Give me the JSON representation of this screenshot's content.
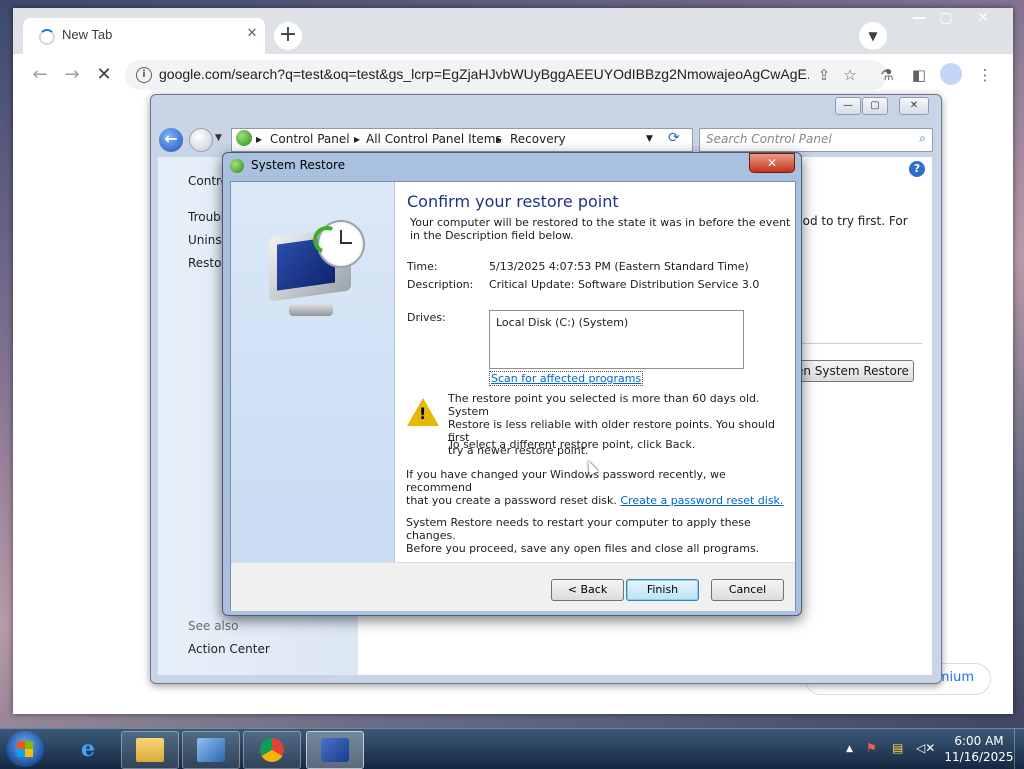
{
  "browser": {
    "tab_title": "New Tab",
    "url": "google.com/search?q=test&oq=test&gs_lcrp=EgZjaHJvbWUyBggAEEUYOdIBBzg2NmowajeoAgCwAgE...",
    "premium_label": "Premium"
  },
  "control_panel": {
    "breadcrumb": [
      "Control Panel",
      "All Control Panel Items",
      "Recovery"
    ],
    "search_placeholder": "Search Control Panel",
    "left_links": [
      "Contro",
      "Troubl",
      "Uninst",
      "Restor"
    ],
    "right_text": "hod to try first. For",
    "open_button": "en System Restore",
    "see_also": "See also",
    "action_center": "Action Center"
  },
  "system_restore": {
    "title": "System Restore",
    "heading": "Confirm your restore point",
    "intro_line1": "Your computer will be restored to the state it was in before the event",
    "intro_line2": "in the Description field below.",
    "time_label": "Time:",
    "time_value": "5/13/2025 4:07:53 PM (Eastern Standard Time)",
    "desc_label": "Description:",
    "desc_value": "Critical Update: Software Distribution Service 3.0",
    "drives_label": "Drives:",
    "drive_item": "Local Disk (C:) (System)",
    "scan_link": "Scan for affected programs",
    "warn_line1": "The restore point you selected is more than 60 days old. System",
    "warn_line2": "Restore is less reliable with older restore points. You should first",
    "warn_line3": "try a newer restore point.",
    "select_back": "To select a different restore point, click Back.",
    "pwd_line1": "If you have changed your Windows password recently, we recommend",
    "pwd_line2": "that you create a password reset disk.",
    "pwd_link": "Create a password reset disk.",
    "restart_line1": "System Restore needs to restart your computer to apply these changes.",
    "restart_line2": "Before you proceed, save any open files and close all programs.",
    "back_button": "< Back",
    "finish_button": "Finish",
    "cancel_button": "Cancel"
  },
  "taskbar": {
    "time": "6:00 AM",
    "date": "11/16/2025"
  }
}
